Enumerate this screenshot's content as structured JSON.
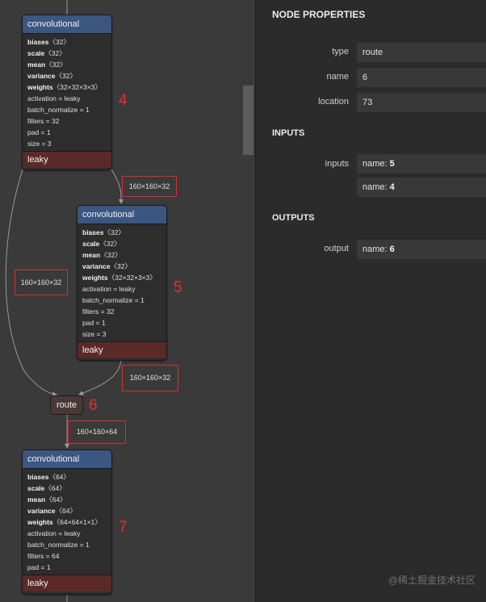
{
  "graph": {
    "node_4": {
      "title": "convolutional",
      "attrs": [
        {
          "k": "biases",
          "v": "〈32〉"
        },
        {
          "k": "scale",
          "v": "〈32〉"
        },
        {
          "k": "mean",
          "v": "〈32〉"
        },
        {
          "k": "variance",
          "v": "〈32〉"
        },
        {
          "k": "weights",
          "v": "〈32×32×3×3〉"
        },
        {
          "k": "",
          "v": "activation = leaky"
        },
        {
          "k": "",
          "v": "batch_normalize = 1"
        },
        {
          "k": "",
          "v": "filters = 32"
        },
        {
          "k": "",
          "v": "pad = 1"
        },
        {
          "k": "",
          "v": "size = 3"
        }
      ],
      "footer": "leaky",
      "annotation": "4"
    },
    "node_5": {
      "title": "convolutional",
      "attrs": [
        {
          "k": "biases",
          "v": "〈32〉"
        },
        {
          "k": "scale",
          "v": "〈32〉"
        },
        {
          "k": "mean",
          "v": "〈32〉"
        },
        {
          "k": "variance",
          "v": "〈32〉"
        },
        {
          "k": "weights",
          "v": "〈32×32×3×3〉"
        },
        {
          "k": "",
          "v": "activation = leaky"
        },
        {
          "k": "",
          "v": "batch_normalize = 1"
        },
        {
          "k": "",
          "v": "filters = 32"
        },
        {
          "k": "",
          "v": "pad = 1"
        },
        {
          "k": "",
          "v": "size = 3"
        }
      ],
      "footer": "leaky",
      "annotation": "5"
    },
    "route": {
      "label": "route",
      "annotation": "6"
    },
    "node_7": {
      "title": "convolutional",
      "attrs": [
        {
          "k": "biases",
          "v": "〈64〉"
        },
        {
          "k": "scale",
          "v": "〈64〉"
        },
        {
          "k": "mean",
          "v": "〈64〉"
        },
        {
          "k": "variance",
          "v": "〈64〉"
        },
        {
          "k": "weights",
          "v": "〈64×64×1×1〉"
        },
        {
          "k": "",
          "v": "activation = leaky"
        },
        {
          "k": "",
          "v": "batch_normalize = 1"
        },
        {
          "k": "",
          "v": "filters = 64"
        },
        {
          "k": "",
          "v": "pad = 1"
        }
      ],
      "footer": "leaky",
      "annotation": "7"
    },
    "edge_labels": {
      "e4_5": "160×160×32",
      "e4_route": "160×160×32",
      "e5_route": "160×160×32",
      "route_7": "160×160×64"
    }
  },
  "panel": {
    "title": "NODE PROPERTIES",
    "properties": [
      {
        "label": "type",
        "value": "route"
      },
      {
        "label": "name",
        "value": "6"
      },
      {
        "label": "location",
        "value": "73"
      }
    ],
    "inputs_title": "INPUTS",
    "inputs_label": "inputs",
    "inputs": [
      {
        "prefix": "name: ",
        "value": "5"
      },
      {
        "prefix": "name: ",
        "value": "4"
      }
    ],
    "outputs_title": "OUTPUTS",
    "output_label": "output",
    "output": {
      "prefix": "name: ",
      "value": "6"
    }
  },
  "watermark": "@稀土掘金技术社区",
  "colors": {
    "node_header": "#3b5680",
    "node_footer": "#5a2a28",
    "annotation_red": "#e03030"
  }
}
